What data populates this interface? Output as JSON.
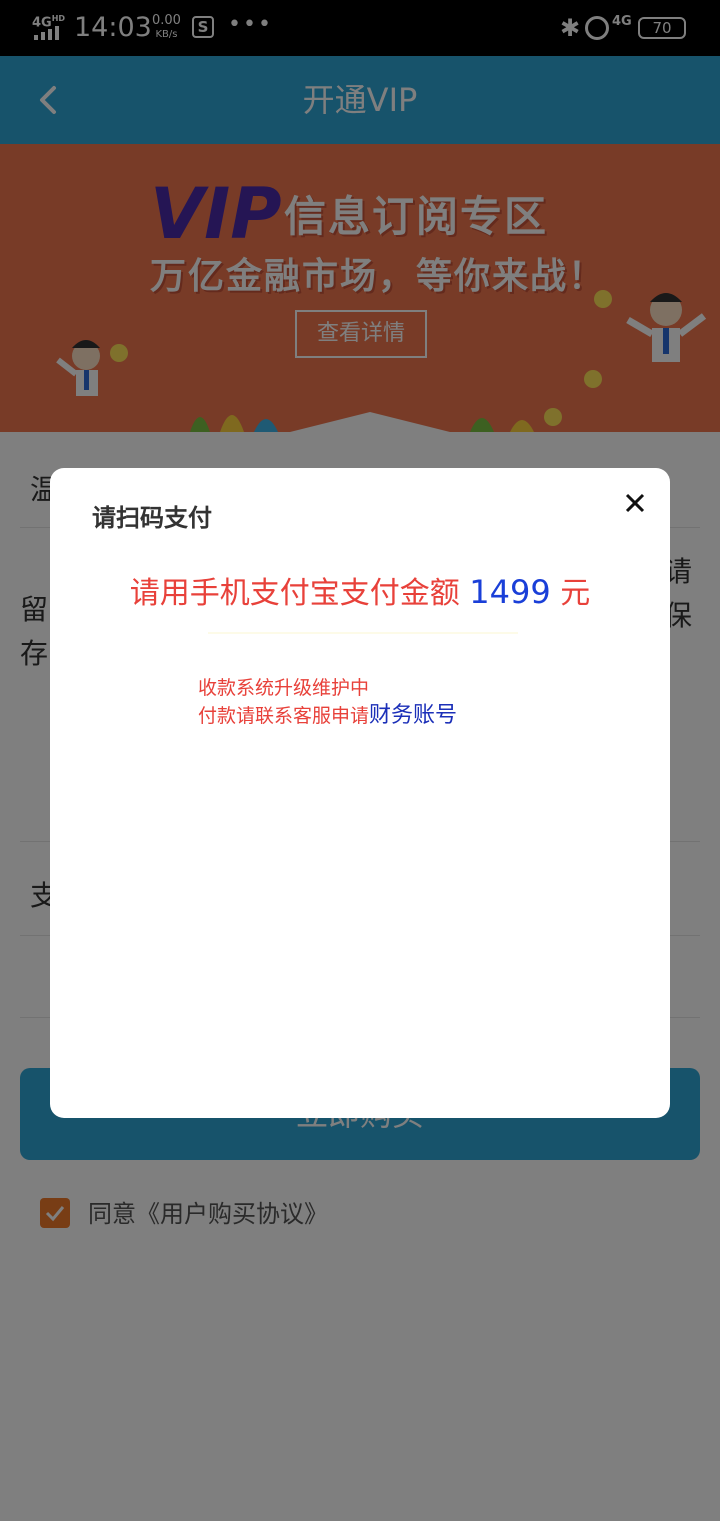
{
  "status_bar": {
    "network": "4G",
    "network_hd": "HD",
    "time": "14:03",
    "speed_value": "0.00",
    "speed_unit": "KB/s",
    "network_right": "4G",
    "battery": "70"
  },
  "header": {
    "title": "开通VIP"
  },
  "banner": {
    "vip": "VIP",
    "title": "信息订阅专区",
    "subtitle": "万亿金融市场，等你来战！",
    "button": "查看详情"
  },
  "form": {
    "row1_label": "温",
    "row2_label_a": "留",
    "row2_label_b": "存",
    "row2_right_a": "请",
    "row2_right_b": "保",
    "row3_label": "支",
    "buy_button": "立即购买",
    "agree": "同意《用户购买协议》"
  },
  "modal": {
    "title": "请扫码支付",
    "pay_prefix": "请用手机支付宝支付金额 ",
    "pay_amount": "1499",
    "pay_suffix": " 元",
    "notice_line1": "收款系统升级维护中",
    "notice_line2": "付款请联系客服申请",
    "notice_link": "财务账号"
  },
  "colors": {
    "header": "#2fa7d6",
    "banner": "#f0764e",
    "alert_red": "#e8413a",
    "amount_blue": "#1a3fd8",
    "check_orange": "#f07a2b"
  }
}
